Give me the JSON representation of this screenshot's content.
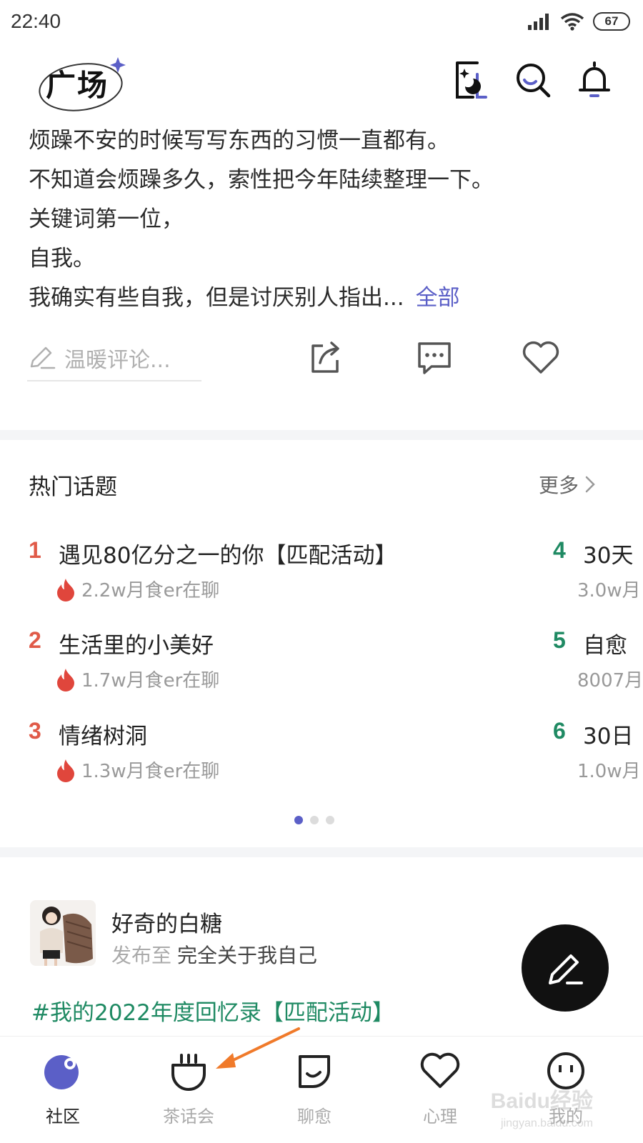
{
  "status_bar": {
    "time": "22:40",
    "battery": "67"
  },
  "header": {
    "logo_text": "广场"
  },
  "post": {
    "lines": [
      "烦躁不安的时候写写东西的习惯一直都有。",
      "不知道会烦躁多久，索性把今年陆续整理一下。",
      "关键词第一位，",
      "自我。",
      "我确实有些自我，但是讨厌别人指出..."
    ],
    "more_label": "全部",
    "comment_placeholder": "温暖评论..."
  },
  "hot_topics": {
    "title": "热门话题",
    "more_label": "更多",
    "items": [
      {
        "rank": "1",
        "title": "遇见80亿分之一的你【匹配活动】",
        "meta": "2.2w月食er在聊"
      },
      {
        "rank": "2",
        "title": "生活里的小美好",
        "meta": "1.7w月食er在聊"
      },
      {
        "rank": "3",
        "title": "情绪树洞",
        "meta": "1.3w月食er在聊"
      },
      {
        "rank": "4",
        "title": "30天",
        "meta": "3.0w月"
      },
      {
        "rank": "5",
        "title": "自愈",
        "meta": "8007月"
      },
      {
        "rank": "6",
        "title": "30日",
        "meta": "1.0w月"
      }
    ],
    "page_dots": 3,
    "active_page": 1
  },
  "feed_post": {
    "username": "好奇的白糖",
    "posted_to_label": "发布至",
    "posted_to": "完全关于我自己",
    "hashtag": "#我的2022年度回忆录【匹配活动】"
  },
  "tab_bar": {
    "tabs": [
      {
        "label": "社区",
        "icon": "community-icon",
        "active": true
      },
      {
        "label": "茶话会",
        "icon": "tea-party-icon",
        "active": false
      },
      {
        "label": "聊愈",
        "icon": "chat-heal-icon",
        "active": false
      },
      {
        "label": "心理",
        "icon": "heart-icon",
        "active": false
      },
      {
        "label": "我的",
        "icon": "profile-face-icon",
        "active": false
      }
    ]
  },
  "watermark": {
    "brand": "Baidu经验",
    "url": "jingyan.baidu.com"
  },
  "colors": {
    "accent": "#5b5fc7",
    "rank_top": "#e05a48",
    "rank_rest": "#1f8a63",
    "hashtag": "#1f8a63",
    "flame": "#e0463c",
    "annotation_arrow": "#f07a2a"
  }
}
